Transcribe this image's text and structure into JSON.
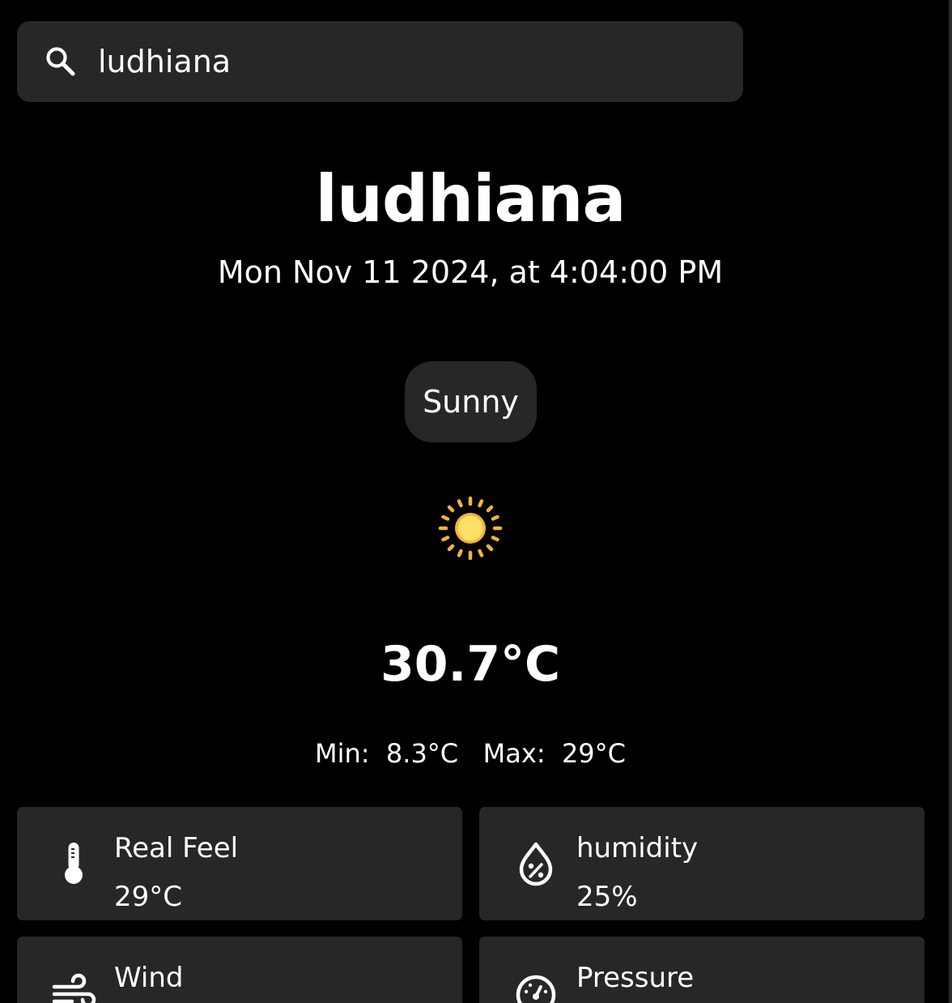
{
  "search": {
    "value": "ludhiana",
    "placeholder": "Search city"
  },
  "location": {
    "city": "ludhiana",
    "datetime": "Mon Nov 11 2024, at 4:04:00 PM"
  },
  "condition": {
    "label": "Sunny",
    "icon": "sun-icon"
  },
  "temperature": {
    "current": "30.7°C",
    "min_label": "Min:",
    "min_value": "8.3°C",
    "max_label": "Max:",
    "max_value": "29°C"
  },
  "details": [
    {
      "label": "Real Feel",
      "value": "29°C",
      "icon": "thermometer-icon"
    },
    {
      "label": "humidity",
      "value": "25%",
      "icon": "humidity-drop-icon"
    },
    {
      "label": "Wind",
      "value": "",
      "icon": "wind-icon"
    },
    {
      "label": "Pressure",
      "value": "",
      "icon": "gauge-icon"
    }
  ],
  "colors": {
    "background": "#000000",
    "card": "#272727",
    "text": "#ffffff",
    "sun_core": "#ffd84a",
    "sun_rays": "#f2b33d"
  }
}
